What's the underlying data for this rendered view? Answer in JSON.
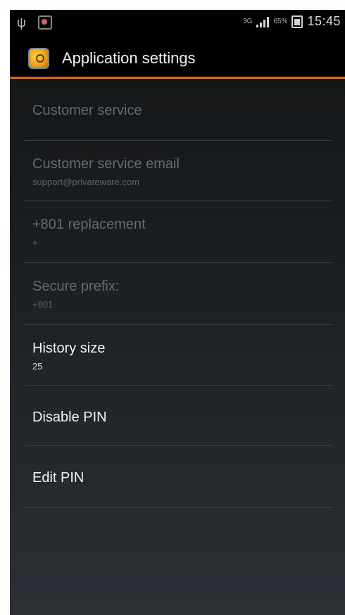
{
  "statusbar": {
    "network": "3G",
    "battery_text": "65%",
    "time": "15:45",
    "icons": [
      "usb-icon",
      "notification-icon",
      "signal-icon",
      "battery-icon"
    ]
  },
  "appbar": {
    "title": "Application settings",
    "icon": "app-icon",
    "accent": "#d86f1a"
  },
  "settings": [
    {
      "title": "Customer service",
      "summary": ""
    },
    {
      "title": "Customer service email",
      "summary": "support@privateware.com"
    },
    {
      "title": "+801 replacement",
      "summary": "+"
    },
    {
      "title": "Secure prefix:",
      "summary": "+801"
    },
    {
      "title": "History size",
      "summary": "25"
    },
    {
      "title": "Disable PIN",
      "summary": ""
    },
    {
      "title": "Edit PIN",
      "summary": ""
    }
  ]
}
